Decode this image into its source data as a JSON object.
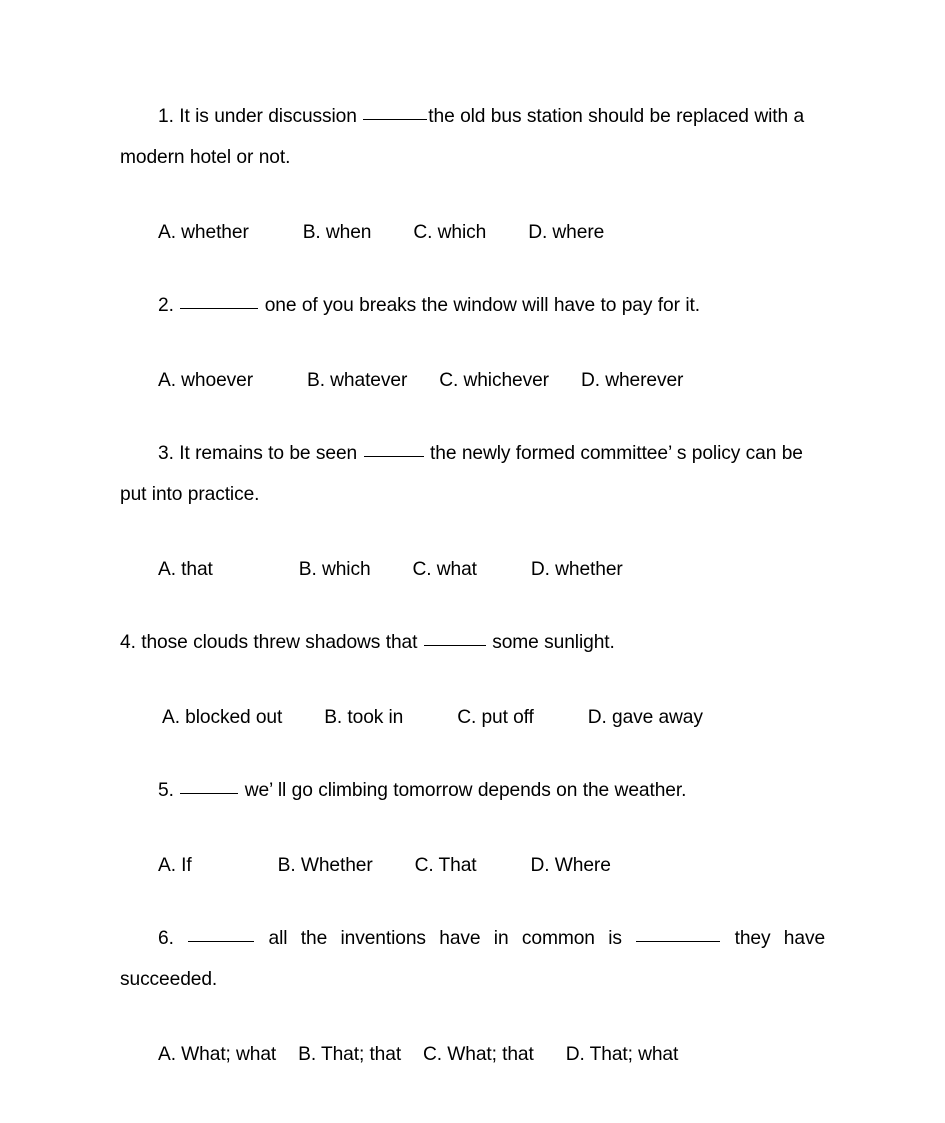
{
  "document": {
    "type": "english-grammar-worksheet",
    "background_color": "#ffffff",
    "text_color": "#000000"
  },
  "questions": [
    {
      "number": "1.",
      "stem_before": "It is under discussion",
      "stem_after": "the old bus station should be replaced with a modern hotel or not.",
      "indent": true,
      "justify": false,
      "options": [
        {
          "label": "A.",
          "text": "whether"
        },
        {
          "label": "B.",
          "text": "when"
        },
        {
          "label": "C.",
          "text": "which"
        },
        {
          "label": "D.",
          "text": "where"
        }
      ]
    },
    {
      "number": "2.",
      "stem_before": "",
      "stem_after": "one of you breaks the window will have to pay for it.",
      "indent": true,
      "justify": false,
      "options": [
        {
          "label": "A.",
          "text": "whoever"
        },
        {
          "label": "B.",
          "text": "whatever"
        },
        {
          "label": "C.",
          "text": "whichever"
        },
        {
          "label": "D.",
          "text": "wherever"
        }
      ]
    },
    {
      "number": "3.",
      "stem_before": "It remains to be seen",
      "stem_after": "the newly formed committee’ s policy can be put into practice.",
      "indent": true,
      "justify": false,
      "options": [
        {
          "label": "A.",
          "text": "that"
        },
        {
          "label": "B.",
          "text": "which"
        },
        {
          "label": "C.",
          "text": "what"
        },
        {
          "label": "D.",
          "text": "whether"
        }
      ]
    },
    {
      "number": "4.",
      "stem_before": "those clouds threw shadows that",
      "stem_after": "some sunlight.",
      "indent": false,
      "justify": false,
      "options": [
        {
          "label": "A.",
          "text": "blocked out"
        },
        {
          "label": "B.",
          "text": "took in"
        },
        {
          "label": "C.",
          "text": "put off"
        },
        {
          "label": "D.",
          "text": "gave away"
        }
      ]
    },
    {
      "number": "5.",
      "stem_before": "",
      "stem_after": "we’ ll go climbing tomorrow depends on the weather.",
      "indent": true,
      "justify": false,
      "options": [
        {
          "label": "A.",
          "text": "If"
        },
        {
          "label": "B.",
          "text": "Whether"
        },
        {
          "label": "C.",
          "text": "That"
        },
        {
          "label": "D.",
          "text": "Where"
        }
      ]
    },
    {
      "number": "6.",
      "stem_before": "",
      "stem_middle": "all the inventions have in common is",
      "stem_after": "they have succeeded.",
      "indent": true,
      "justify": true,
      "options": [
        {
          "label": "A.",
          "text": "What; what"
        },
        {
          "label": "B.",
          "text": "That; that"
        },
        {
          "label": "C.",
          "text": "What; that"
        },
        {
          "label": "D.",
          "text": "That; what"
        }
      ]
    }
  ]
}
